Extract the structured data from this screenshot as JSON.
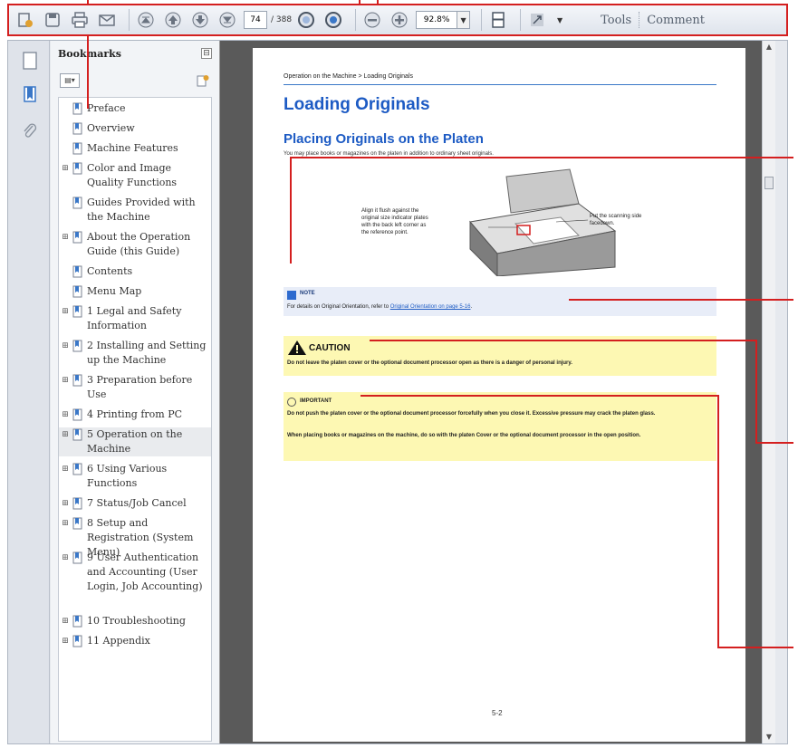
{
  "toolbar": {
    "page_number": "74",
    "page_total": "/ 388",
    "zoom": "92.8%",
    "tools_label": "Tools",
    "comment_label": "Comment",
    "icons": [
      "create-icon",
      "save-icon",
      "print-icon",
      "email-icon",
      "first-page-icon",
      "previous-page-icon",
      "next-page-icon",
      "last-page-icon",
      "previous-view-icon",
      "next-view-icon",
      "zoom-out-icon",
      "zoom-in-icon",
      "fit-page-icon",
      "fullscreen-icon"
    ]
  },
  "bookmarks": {
    "title": "Bookmarks",
    "collapse_symbol": "⊟",
    "items": [
      {
        "label": "Preface",
        "expandable": false
      },
      {
        "label": "Overview",
        "expandable": false
      },
      {
        "label": "Machine Features",
        "expandable": false
      },
      {
        "label": "Color and Image Quality Functions",
        "expandable": true
      },
      {
        "label": "Guides Provided with the Machine",
        "expandable": false
      },
      {
        "label": "About the Operation Guide (this Guide)",
        "expandable": true
      },
      {
        "label": "Contents",
        "expandable": false
      },
      {
        "label": "Menu Map",
        "expandable": false
      },
      {
        "label": "1 Legal and Safety Information",
        "expandable": true
      },
      {
        "label": "2 Installing and Setting up the Machine",
        "expandable": true
      },
      {
        "label": "3 Preparation before Use",
        "expandable": true
      },
      {
        "label": "4 Printing from PC",
        "expandable": true
      },
      {
        "label": "5 Operation on the Machine",
        "expandable": true,
        "active": true
      },
      {
        "label": "6 Using Various Functions",
        "expandable": true
      },
      {
        "label": "7 Status/Job Cancel",
        "expandable": true
      },
      {
        "label": "8 Setup and Registration (System Menu)",
        "expandable": true
      },
      {
        "label": "9 User Authentication and Accounting (User Login, Job Accounting)",
        "expandable": true
      },
      {
        "label": "10 Troubleshooting",
        "expandable": true
      },
      {
        "label": "11 Appendix",
        "expandable": true
      }
    ]
  },
  "page": {
    "breadcrumb": "Operation on the Machine > Loading Originals",
    "heading": "Loading Originals",
    "subheading": "Placing Originals on the Platen",
    "intro": "You may place books or magazines on the platen in addition to ordinary sheet originals.",
    "figure_label_left": "Align it flush against the original size indicator plates with the back left corner as the reference point.",
    "figure_label_right": "Put the scanning side facedown.",
    "note_title": "NOTE",
    "note_text": "For details on Original Orientation, refer to ",
    "note_link": "Original Orientation on page 5-16",
    "note_end": ".",
    "caution_title": "CAUTION",
    "caution_text": "Do not leave the platen cover or the optional document processor open as there is a danger of personal injury.",
    "important_title": "IMPORTANT",
    "important_text_1": "Do not push the platen cover or the optional document processor forcefully when you close it. Excessive pressure may crack the platen glass.",
    "important_text_2": "When placing books or magazines on the machine, do so with the platen Cover or the optional document processor in the open position.",
    "page_number": "5-2"
  },
  "colors": {
    "callout": "#d41f1f",
    "heading": "#1d5bc4",
    "caution_bg": "#fdf8b3",
    "note_bg": "#e8edf8"
  }
}
